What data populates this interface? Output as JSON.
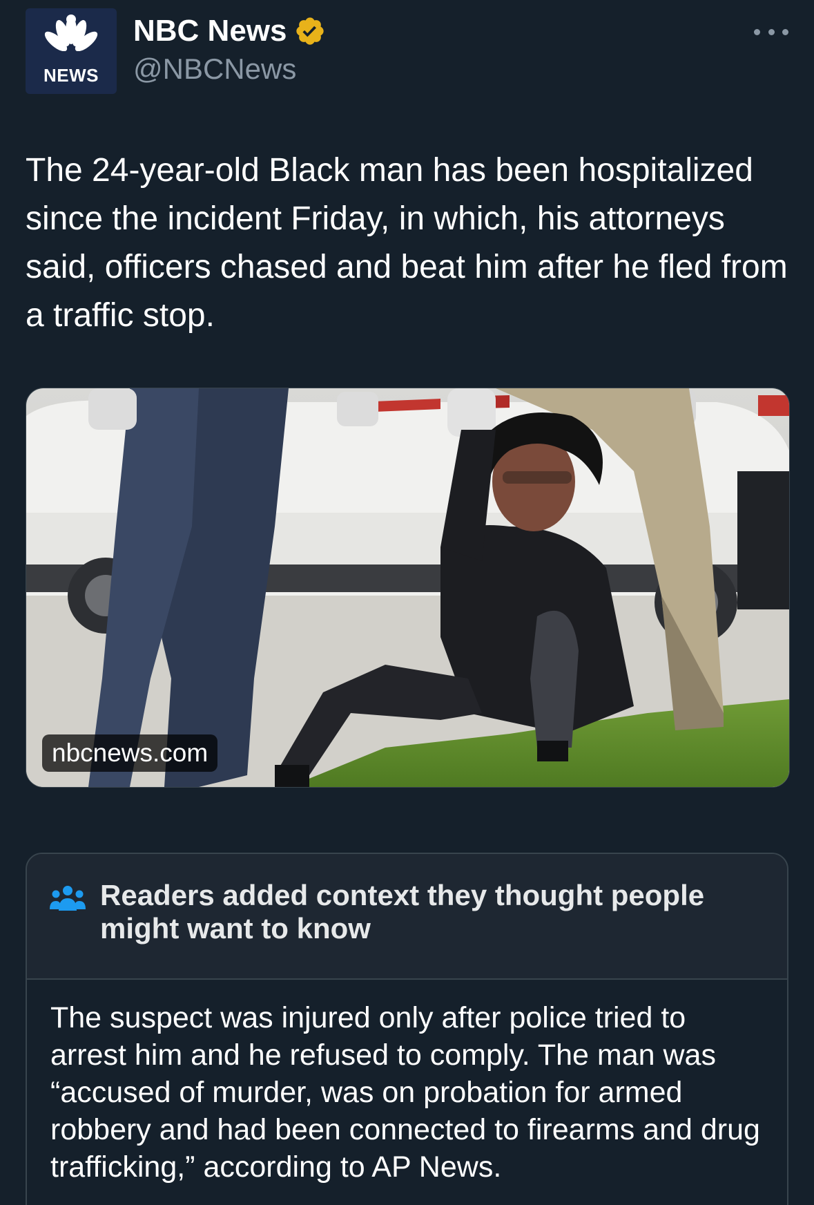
{
  "author": {
    "display_name": "NBC News",
    "handle": "@NBCNews",
    "avatar_label": "NEWS",
    "verified_color": "#e8b21a"
  },
  "tweet": {
    "text": "The 24-year-old Black man has been hospitalized since the incident Friday, in which, his attorneys said, officers chased and beat him after he fled from a traffic stop."
  },
  "media": {
    "domain": "nbcnews.com"
  },
  "community_note": {
    "title": "Readers added context they thought people might want to know",
    "body": "The suspect was injured only after police tried to arrest him and he refused to comply. The man was “accused of murder, was on probation for armed robbery and had been connected to firearms and drug trafficking,” according to AP News.",
    "icon": "people-icon",
    "accent_color": "#1d9bf0"
  },
  "icons": {
    "more": "more-icon",
    "verified": "verified-badge-icon",
    "logo": "peacock-icon"
  },
  "colors": {
    "background": "#15202b",
    "secondary_text": "#8b98a5",
    "border": "#38444d"
  }
}
